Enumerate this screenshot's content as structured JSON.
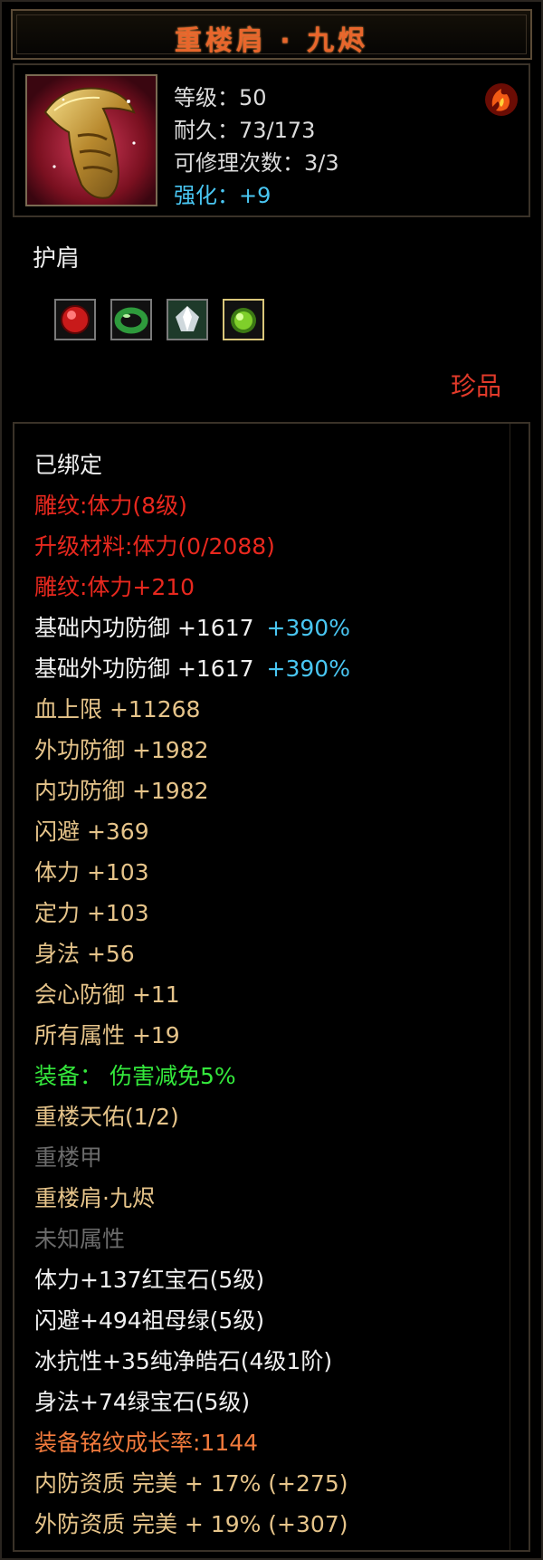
{
  "item": {
    "name": "重楼肩 · 九烬",
    "type": "护肩",
    "rarity": "珍品"
  },
  "stats": {
    "level": "等级：50",
    "durability": "耐久：73/173",
    "repairs": "可修理次数：3/3",
    "enhance": "强化：+9"
  },
  "gems": [
    {
      "icon": "red-gem-icon",
      "color": "#c81a1a"
    },
    {
      "icon": "jade-ring-gem-icon",
      "color": "#2e9a3c"
    },
    {
      "icon": "white-crystal-gem-icon",
      "color": "#cfd8dc"
    },
    {
      "icon": "green-gem-icon",
      "color": "#7fcf2a"
    }
  ],
  "colors": {
    "title": "#e8662c",
    "bound": "#f0f0f0",
    "engrave": "#e8281e",
    "attribute": "#e6c48a",
    "equip_bonus": "#34e83c",
    "inactive": "#6c6c6c",
    "growth": "#f27a3c",
    "percent": "#49c6f2"
  },
  "attributes": {
    "bound": "已绑定",
    "engrave_level": "雕纹:体力(8级)",
    "upgrade_material": "升级材料:体力(0/2088)",
    "engrave_bonus": "雕纹:体力+210",
    "base_inner_def": {
      "label": "基础内功防御  +1617",
      "pct": "+390%"
    },
    "base_outer_def": {
      "label": "基础外功防御  +1617",
      "pct": "+390%"
    },
    "hp_cap": "血上限  +11268",
    "outer_def": "外功防御  +1982",
    "inner_def": "内功防御  +1982",
    "dodge": "闪避  +369",
    "stamina": "体力  +103",
    "focus": "定力  +103",
    "agility": "身法  +56",
    "crit_def": "会心防御  +11",
    "all_attr": "所有属性  +19",
    "equip_bonus": "装备：  伤害减免5%",
    "set_name": "重楼天佑(1/2)",
    "set_piece_1": "重楼甲",
    "set_piece_2": "重楼肩·九烬",
    "unknown": "未知属性",
    "gem_1": "体力+137红宝石(5级)",
    "gem_2": "闪避+494祖母绿(5级)",
    "gem_3": "冰抗性+35纯净皓石(4级1阶)",
    "gem_4": "身法+74绿宝石(5级)",
    "growth": "装备铭纹成长率:1144",
    "inner_quality": "内防资质  完美  +  17%  (+275)",
    "outer_quality": "外防资质  完美  +  19%  (+307)"
  }
}
